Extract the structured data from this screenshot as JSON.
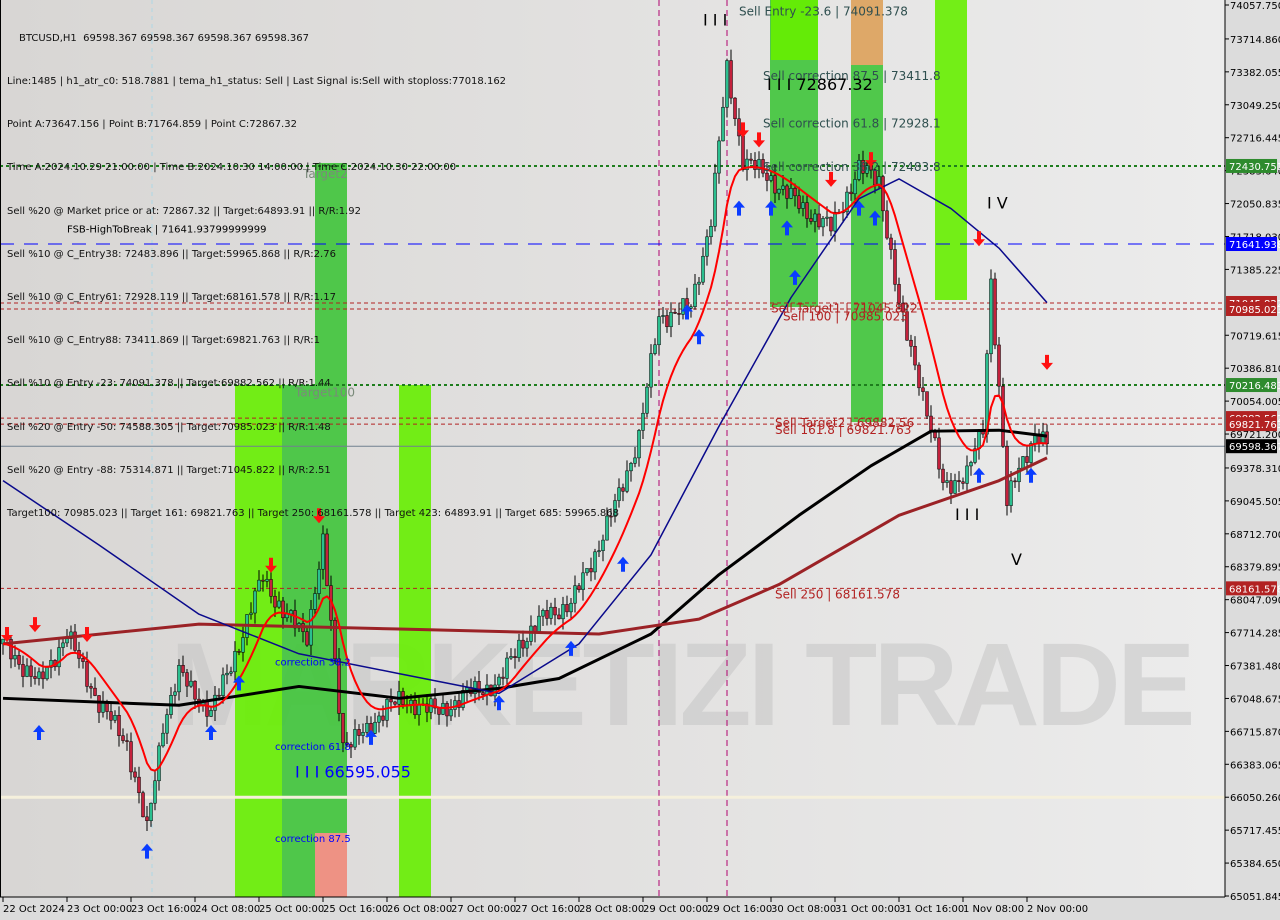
{
  "header": {
    "symbol_line": "BTCUSD,H1  69598.367 69598.367 69598.367 69598.367",
    "lines": [
      "Line:1485 | h1_atr_c0: 518.7881 | tema_h1_status: Sell | Last Signal is:Sell with stoploss:77018.162",
      "Point A:73647.156 | Point B:71764.859 | Point C:72867.32",
      "Time A:2024.10.29 21:00:00 | Time B:2024.10.30 14:00:00 | Time C:2024.10.30 22:00:00",
      "Sell %20 @ Market price or at: 72867.32 || Target:64893.91 || R/R:1.92",
      "Sell %10 @ C_Entry38: 72483.896 || Target:59965.868 || R/R:2.76",
      "Sell %10 @ C_Entry61: 72928.119 || Target:68161.578 || R/R:1.17",
      "Sell %10 @ C_Entry88: 73411.869 || Target:69821.763 || R/R:1",
      "Sell %10 @ Entry -23: 74091.378 || Target:69882.562 || R/R:1.44",
      "Sell %20 @ Entry -50: 74588.305 || Target:70985.023 || R/R:1.48",
      "Sell %20 @ Entry -88: 75314.871 || Target:71045.822 || R/R:2.51",
      "Target100: 70985.023 || Target 161: 69821.763 || Target 250: 68161.578 || Target 423: 64893.91 || Target 685: 59965.868"
    ]
  },
  "watermark": "MARKETIZI TRADE",
  "colors": {
    "background": "#dcdcdc",
    "bull_candle": "#2bbf8f",
    "bear_candle": "#c4213c",
    "ma_black": "#000000",
    "ma_darkred": "#9b2226",
    "ma_blue": "#0a0a8c",
    "ma_red": "#ff0000",
    "zone_green": "#3fc43a",
    "zone_lime": "#66ee00",
    "zone_orange": "#dda15a",
    "zone_pink": "#f08a7a"
  },
  "chart_data": {
    "type": "candlestick",
    "symbol": "BTCUSD",
    "timeframe": "H1",
    "ylim": [
      65051.845,
      74057.75
    ],
    "y_ticks": [
      74057.75,
      73714.86,
      73382.055,
      73049.25,
      72716.445,
      72383.64,
      72050.835,
      71718.03,
      71385.225,
      70719.615,
      70386.81,
      70054.005,
      69721.2,
      69378.31,
      69045.505,
      68712.7,
      68379.895,
      68047.09,
      67714.285,
      67381.48,
      67048.675,
      66715.87,
      66383.065,
      66050.26,
      65717.455,
      65384.65,
      65051.845
    ],
    "x_ticks": [
      {
        "t": "2024-10-22 08:00",
        "label": "22 Oct 2024"
      },
      {
        "t": "2024-10-23 00:00",
        "label": "23 Oct 00:00"
      },
      {
        "t": "2024-10-23 16:00",
        "label": "23 Oct 16:00"
      },
      {
        "t": "2024-10-24 08:00",
        "label": "24 Oct 08:00"
      },
      {
        "t": "2024-10-25 00:00",
        "label": "25 Oct 00:00"
      },
      {
        "t": "2024-10-25 16:00",
        "label": "25 Oct 16:00"
      },
      {
        "t": "2024-10-26 08:00",
        "label": "26 Oct 08:00"
      },
      {
        "t": "2024-10-27 00:00",
        "label": "27 Oct 00:00"
      },
      {
        "t": "2024-10-27 16:00",
        "label": "27 Oct 16:00"
      },
      {
        "t": "2024-10-28 08:00",
        "label": "28 Oct 08:00"
      },
      {
        "t": "2024-10-29 00:00",
        "label": "29 Oct 00:00"
      },
      {
        "t": "2024-10-29 16:00",
        "label": "29 Oct 16:00"
      },
      {
        "t": "2024-10-30 08:00",
        "label": "30 Oct 08:00"
      },
      {
        "t": "2024-10-31 00:00",
        "label": "31 Oct 00:00"
      },
      {
        "t": "2024-10-31 16:00",
        "label": "31 Oct 16:00"
      },
      {
        "t": "2024-11-01 08:00",
        "label": "1 Nov 08:00"
      },
      {
        "t": "2024-11-02 00:00",
        "label": "2 Nov 00:00"
      }
    ],
    "close_path": [
      [
        "2024-10-22 08:00",
        67600
      ],
      [
        "2024-10-22 17:00",
        67200
      ],
      [
        "2024-10-23 00:00",
        67700
      ],
      [
        "2024-10-23 08:00",
        67000
      ],
      [
        "2024-10-23 15:00",
        66600
      ],
      [
        "2024-10-23 20:00",
        65700
      ],
      [
        "2024-10-24 00:00",
        66800
      ],
      [
        "2024-10-24 04:00",
        67300
      ],
      [
        "2024-10-24 12:00",
        66900
      ],
      [
        "2024-10-24 20:00",
        67700
      ],
      [
        "2024-10-25 01:00",
        68300
      ],
      [
        "2024-10-25 06:00",
        67900
      ],
      [
        "2024-10-25 12:00",
        67700
      ],
      [
        "2024-10-25 16:00",
        68600
      ],
      [
        "2024-10-25 21:00",
        66600
      ],
      [
        "2024-10-26 03:00",
        66700
      ],
      [
        "2024-10-26 08:00",
        67000
      ],
      [
        "2024-10-26 16:00",
        67000
      ],
      [
        "2024-10-26 21:00",
        66900
      ],
      [
        "2024-10-27 04:00",
        67100
      ],
      [
        "2024-10-27 12:00",
        67200
      ],
      [
        "2024-10-27 17:00",
        67600
      ],
      [
        "2024-10-28 00:00",
        67900
      ],
      [
        "2024-10-28 06:00",
        68000
      ],
      [
        "2024-10-28 13:00",
        68600
      ],
      [
        "2024-10-28 18:00",
        69100
      ],
      [
        "2024-10-28 23:00",
        69700
      ],
      [
        "2024-10-29 04:00",
        70900
      ],
      [
        "2024-10-29 12:00",
        71000
      ],
      [
        "2024-10-29 17:00",
        71900
      ],
      [
        "2024-10-29 21:00",
        73400
      ],
      [
        "2024-10-30 01:00",
        72500
      ],
      [
        "2024-10-30 08:00",
        72300
      ],
      [
        "2024-10-30 16:00",
        72000
      ],
      [
        "2024-10-30 23:00",
        71800
      ],
      [
        "2024-10-31 06:00",
        72400
      ],
      [
        "2024-10-31 11:00",
        72300
      ],
      [
        "2024-10-31 16:00",
        71000
      ],
      [
        "2024-10-31 21:00",
        70300
      ],
      [
        "2024-11-01 03:00",
        69200
      ],
      [
        "2024-11-01 09:00",
        69300
      ],
      [
        "2024-11-01 13:00",
        69800
      ],
      [
        "2024-11-01 15:00",
        71300
      ],
      [
        "2024-11-01 19:00",
        69000
      ],
      [
        "2024-11-01 22:00",
        69400
      ],
      [
        "2024-11-02 02:00",
        69700
      ],
      [
        "2024-11-02 05:00",
        69598.367
      ]
    ],
    "series": [
      {
        "key": "ma_black",
        "values": [
          [
            "2024-10-22 08:00",
            67050
          ],
          [
            "2024-10-24 04:00",
            66980
          ],
          [
            "2024-10-25 10:00",
            67170
          ],
          [
            "2024-10-26 11:00",
            67050
          ],
          [
            "2024-10-27 12:00",
            67150
          ],
          [
            "2024-10-28 03:00",
            67250
          ],
          [
            "2024-10-29 02:00",
            67700
          ],
          [
            "2024-10-29 19:00",
            68300
          ],
          [
            "2024-10-30 15:00",
            68900
          ],
          [
            "2024-10-31 09:00",
            69400
          ],
          [
            "2024-11-01 00:00",
            69750
          ],
          [
            "2024-11-01 17:00",
            69760
          ],
          [
            "2024-11-02 05:00",
            69700
          ]
        ]
      },
      {
        "key": "ma_darkred",
        "values": [
          [
            "2024-10-22 08:00",
            67600
          ],
          [
            "2024-10-24 09:00",
            67800
          ],
          [
            "2024-10-26 11:00",
            67750
          ],
          [
            "2024-10-28 13:00",
            67700
          ],
          [
            "2024-10-29 14:00",
            67850
          ],
          [
            "2024-10-30 10:00",
            68200
          ],
          [
            "2024-10-31 16:00",
            68900
          ],
          [
            "2024-11-01 17:00",
            69250
          ],
          [
            "2024-11-02 05:00",
            69480
          ]
        ]
      },
      {
        "key": "ma_blue",
        "values": [
          [
            "2024-10-22 08:00",
            69250
          ],
          [
            "2024-10-23 08:00",
            68600
          ],
          [
            "2024-10-24 09:00",
            67900
          ],
          [
            "2024-10-25 10:00",
            67500
          ],
          [
            "2024-10-26 11:00",
            67300
          ],
          [
            "2024-10-27 12:00",
            67100
          ],
          [
            "2024-10-28 08:00",
            67600
          ],
          [
            "2024-10-29 02:00",
            68500
          ],
          [
            "2024-10-29 19:00",
            69800
          ],
          [
            "2024-10-30 13:00",
            71100
          ],
          [
            "2024-10-31 06:00",
            72100
          ],
          [
            "2024-10-31 16:00",
            72300
          ],
          [
            "2024-11-01 05:00",
            72000
          ],
          [
            "2024-11-01 17:00",
            71600
          ],
          [
            "2024-11-02 05:00",
            71050
          ]
        ]
      }
    ],
    "levels": [
      {
        "price": 72430.751,
        "label": "72430.751",
        "style": "green-dotted"
      },
      {
        "price": 71641.938,
        "label": "71641.938",
        "style": "blue-dashed"
      },
      {
        "price": 71045.822,
        "label": "71045.822",
        "style": "red-dashed"
      },
      {
        "price": 70985.023,
        "label": "70985.023",
        "style": "red-dashed"
      },
      {
        "price": 70216.483,
        "label": "70216.483",
        "style": "green-dotted"
      },
      {
        "price": 69882.562,
        "label": "69882.562",
        "style": "red-dashed"
      },
      {
        "price": 69821.763,
        "label": "69821.763",
        "style": "red-dashed"
      },
      {
        "price": 69598.367,
        "label": "69598.367",
        "style": "current"
      },
      {
        "price": 68161.578,
        "label": "68161.578",
        "style": "red-dashed"
      },
      {
        "price": 66050.26,
        "label": "",
        "style": "cream"
      }
    ],
    "annotations": [
      {
        "text": "Sell Entry -23.6 | 74091.378",
        "t": "2024-10-30 00:00",
        "price": 73950,
        "color": "#2f4f4f"
      },
      {
        "text": "Sell correction 87.5 | 73411.8",
        "t": "2024-10-30 06:00",
        "price": 73300,
        "color": "#2f4f4f"
      },
      {
        "text": "I I I 72867.32",
        "t": "2024-10-30 07:00",
        "price": 73200,
        "color": "#000000",
        "big": true
      },
      {
        "text": "Sell correction 61.8 | 72928.1",
        "t": "2024-10-30 06:00",
        "price": 72820,
        "color": "#2f4f4f"
      },
      {
        "text": "Sell correction 38.2 | 72483.8",
        "t": "2024-10-30 06:00",
        "price": 72380,
        "color": "#2f4f4f"
      },
      {
        "text": "Sell Target1 | 71045.822",
        "t": "2024-10-30 08:00",
        "price": 70950,
        "color": "#b22222"
      },
      {
        "text": "Sell 100 | 70985.023",
        "t": "2024-10-30 11:00",
        "price": 70870,
        "color": "#b22222"
      },
      {
        "text": "Sell Target2 | 69882.56",
        "t": "2024-10-30 09:00",
        "price": 69790,
        "color": "#b22222"
      },
      {
        "text": "Sell 161.8 | 69821.763",
        "t": "2024-10-30 09:00",
        "price": 69720,
        "color": "#b22222"
      },
      {
        "text": "Sell 250 | 68161.578",
        "t": "2024-10-30 09:00",
        "price": 68060,
        "color": "#b22222"
      },
      {
        "text": "correction 38.2",
        "t": "2024-10-25 04:00",
        "price": 67380,
        "color": "#0000ff",
        "small": true
      },
      {
        "text": "correction 61.8",
        "t": "2024-10-25 04:00",
        "price": 66530,
        "color": "#0000ff",
        "small": true
      },
      {
        "text": "I I I 66595.055",
        "t": "2024-10-25 09:00",
        "price": 66250,
        "color": "#0000ff",
        "big": true
      },
      {
        "text": "correction 87.5",
        "t": "2024-10-25 04:00",
        "price": 65600,
        "color": "#0000ff",
        "small": true
      },
      {
        "text": "Target2",
        "t": "2024-10-25 11:00",
        "price": 72310,
        "color": "#7a8a7a"
      },
      {
        "text": "Target100",
        "t": "2024-10-25 09:00",
        "price": 70100,
        "color": "#7a8a7a"
      },
      {
        "text": "FSB-HighToBreak | 71641.93799999999",
        "t": "2024-10-22 24:00",
        "price": 71760,
        "color": "#000000",
        "small": true
      },
      {
        "text": "I V",
        "t": "2024-11-01 14:00",
        "price": 72000,
        "color": "#000000",
        "big": true
      },
      {
        "text": "I I I",
        "t": "2024-11-01 06:00",
        "price": 68850,
        "color": "#000000",
        "big": true
      },
      {
        "text": "V",
        "t": "2024-11-01 20:00",
        "price": 68400,
        "color": "#000000",
        "big": true
      },
      {
        "text": "I I I",
        "t": "2024-10-29 15:00",
        "price": 73850,
        "color": "#000000",
        "big": true
      }
    ],
    "signals": [
      {
        "t": "2024-10-22 09:00",
        "price": 67700,
        "dir": "down"
      },
      {
        "t": "2024-10-22 16:00",
        "price": 67800,
        "dir": "down"
      },
      {
        "t": "2024-10-23 05:00",
        "price": 67700,
        "dir": "down"
      },
      {
        "t": "2024-10-22 17:00",
        "price": 66700,
        "dir": "up"
      },
      {
        "t": "2024-10-23 20:00",
        "price": 65500,
        "dir": "up"
      },
      {
        "t": "2024-10-24 12:00",
        "price": 66700,
        "dir": "up"
      },
      {
        "t": "2024-10-24 19:00",
        "price": 67200,
        "dir": "up"
      },
      {
        "t": "2024-10-25 03:00",
        "price": 68400,
        "dir": "down"
      },
      {
        "t": "2024-10-25 15:00",
        "price": 68900,
        "dir": "down"
      },
      {
        "t": "2024-10-26 04:00",
        "price": 66650,
        "dir": "up"
      },
      {
        "t": "2024-10-27 12:00",
        "price": 67000,
        "dir": "up"
      },
      {
        "t": "2024-10-28 06:00",
        "price": 67550,
        "dir": "up"
      },
      {
        "t": "2024-10-28 19:00",
        "price": 68400,
        "dir": "up"
      },
      {
        "t": "2024-10-29 14:00",
        "price": 70700,
        "dir": "up"
      },
      {
        "t": "2024-10-29 11:00",
        "price": 70950,
        "dir": "up"
      },
      {
        "t": "2024-10-30 00:00",
        "price": 72000,
        "dir": "up"
      },
      {
        "t": "2024-10-30 01:00",
        "price": 72800,
        "dir": "down"
      },
      {
        "t": "2024-10-30 05:00",
        "price": 72700,
        "dir": "down"
      },
      {
        "t": "2024-10-30 08:00",
        "price": 72000,
        "dir": "up"
      },
      {
        "t": "2024-10-30 12:00",
        "price": 71800,
        "dir": "up"
      },
      {
        "t": "2024-10-30 14:00",
        "price": 71300,
        "dir": "up"
      },
      {
        "t": "2024-10-30 23:00",
        "price": 72300,
        "dir": "down"
      },
      {
        "t": "2024-10-31 06:00",
        "price": 72000,
        "dir": "up"
      },
      {
        "t": "2024-10-31 09:00",
        "price": 72500,
        "dir": "down"
      },
      {
        "t": "2024-10-31 10:00",
        "price": 71900,
        "dir": "up"
      },
      {
        "t": "2024-11-01 12:00",
        "price": 71700,
        "dir": "down"
      },
      {
        "t": "2024-11-01 12:00",
        "price": 69300,
        "dir": "up"
      },
      {
        "t": "2024-11-02 01:00",
        "price": 69300,
        "dir": "up"
      },
      {
        "t": "2024-11-02 05:00",
        "price": 70450,
        "dir": "down"
      }
    ]
  }
}
